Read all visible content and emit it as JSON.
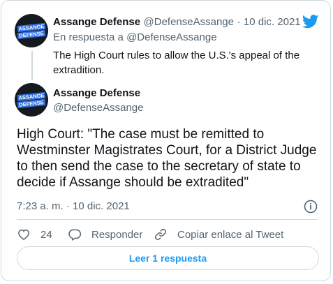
{
  "reply_tweet": {
    "author_name": "Assange Defense",
    "author_handle": "@DefenseAssange",
    "separator": "·",
    "date": "10 dic. 2021",
    "reply_context": "En respuesta a @DefenseAssange",
    "text": "The High Court rules to allow the U.S.'s appeal of the extradition.",
    "avatar_lines": [
      "ASSANGE",
      "DEFENSE"
    ]
  },
  "main_tweet": {
    "author_name": "Assange Defense",
    "author_handle": "@DefenseAssange",
    "text": "High Court: \"The case must be remitted to Westminster Magistrates Court, for a District Judge to then send the case to the secretary of state to decide if Assange should be extradited\"",
    "timestamp": "7:23 a. m. · 10 dic. 2021",
    "avatar_lines": [
      "ASSANGE",
      "DEFENSE"
    ]
  },
  "actions": {
    "like_count": "24",
    "reply_label": "Responder",
    "copy_link_label": "Copiar enlace al Tweet"
  },
  "read_replies_label": "Leer 1 respuesta",
  "colors": {
    "accent": "#1d9bf0",
    "muted": "#536471",
    "text": "#0f1419",
    "border": "#cfd9de",
    "avatar_bg": "#141a20",
    "avatar_stripe": "#2f6fe0"
  },
  "icons": [
    "twitter-bird-icon",
    "info-icon",
    "heart-icon",
    "reply-icon",
    "link-icon"
  ]
}
